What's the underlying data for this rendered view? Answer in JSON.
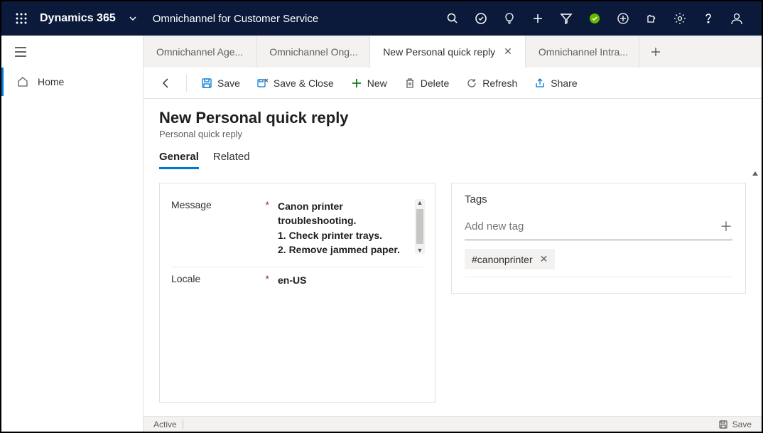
{
  "header": {
    "brand": "Dynamics 365",
    "module": "Omnichannel for Customer Service"
  },
  "nav": {
    "home_label": "Home"
  },
  "tabs": [
    {
      "label": "Omnichannel Age..."
    },
    {
      "label": "Omnichannel Ong..."
    },
    {
      "label": "New Personal quick reply"
    },
    {
      "label": "Omnichannel Intra..."
    }
  ],
  "commands": {
    "save": "Save",
    "save_close": "Save & Close",
    "new": "New",
    "delete": "Delete",
    "refresh": "Refresh",
    "share": "Share"
  },
  "page": {
    "title": "New Personal quick reply",
    "subtitle": "Personal quick reply"
  },
  "form_tabs": {
    "general": "General",
    "related": "Related"
  },
  "fields": {
    "message_label": "Message",
    "message_value": "Canon printer troubleshooting.\n1. Check printer trays.\n2. Remove jammed paper.",
    "locale_label": "Locale",
    "locale_value": "en-US"
  },
  "tags": {
    "section_title": "Tags",
    "placeholder": "Add new tag",
    "chip": "#canonprinter"
  },
  "status": {
    "state": "Active",
    "save": "Save"
  }
}
